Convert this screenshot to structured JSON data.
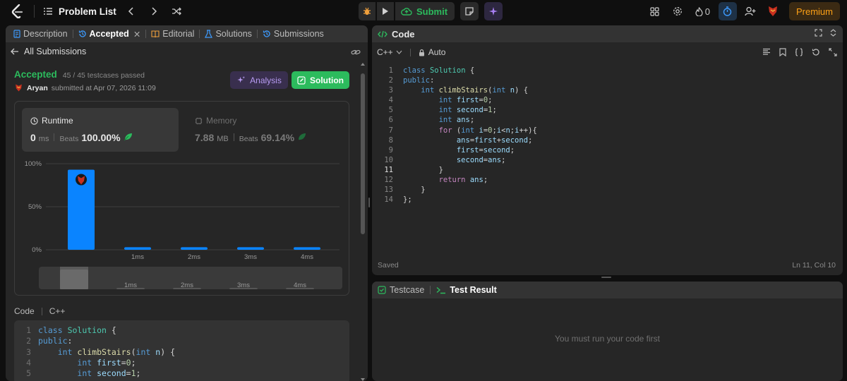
{
  "topbar": {
    "problem_list": "Problem List",
    "submit_label": "Submit",
    "streak_count": "0",
    "premium_label": "Premium"
  },
  "left": {
    "tabs": [
      "Description",
      "Accepted",
      "Editorial",
      "Solutions",
      "Submissions"
    ],
    "all_submissions": "All Submissions",
    "status": "Accepted",
    "testcases": "45 / 45 testcases passed",
    "user": "Aryan",
    "submitted_text": "submitted at Apr 07, 2026 11:09",
    "analysis_label": "Analysis",
    "solution_label": "Solution",
    "runtime_label": "Runtime",
    "runtime_value": "0",
    "runtime_unit": "ms",
    "runtime_beats_label": "Beats",
    "runtime_beats": "100.00%",
    "memory_label": "Memory",
    "memory_value": "7.88",
    "memory_unit": "MB",
    "memory_beats_label": "Beats",
    "memory_beats": "69.14%",
    "code_label": "Code",
    "code_lang": "C++"
  },
  "chart_data": {
    "type": "bar",
    "categories": [
      "0ms",
      "1ms",
      "2ms",
      "3ms",
      "4ms"
    ],
    "values": [
      93,
      3,
      3,
      3,
      3
    ],
    "tick_labels": [
      "",
      "1ms",
      "2ms",
      "3ms",
      "4ms"
    ],
    "ylim": [
      0,
      100
    ],
    "yticks": [
      "100%",
      "50%",
      "0%"
    ],
    "highlight_index": 0,
    "bar_color": "#0a84ff",
    "mini_labels": [
      "1ms",
      "2ms",
      "3ms",
      "4ms"
    ]
  },
  "left_code_lines": [
    {
      "n": "1",
      "t": "class Solution {"
    },
    {
      "n": "2",
      "t": "public:"
    },
    {
      "n": "3",
      "t": "    int climbStairs(int n) {"
    },
    {
      "n": "4",
      "t": "        int first=0;"
    },
    {
      "n": "5",
      "t": "        int second=1;"
    }
  ],
  "code_panel": {
    "title": "Code",
    "language": "C++",
    "mode": "Auto",
    "saved": "Saved",
    "cursor": "Ln 11, Col 10",
    "lines": [
      "class Solution {",
      "public:",
      "    int climbStairs(int n) {",
      "        int first=0;",
      "        int second=1;",
      "        int ans;",
      "        for (int i=0;i<n;i++){",
      "            ans=first+second;",
      "            first=second;",
      "            second=ans;",
      "        }",
      "        return ans;",
      "    }",
      "};"
    ]
  },
  "test_panel": {
    "tab1": "Testcase",
    "tab2": "Test Result",
    "message": "You must run your code first"
  },
  "colors": {
    "accent_green": "#2cbb5d",
    "premium_orange": "#ffa116",
    "analysis_purple": "#b79bf2",
    "bar_blue": "#0a84ff"
  }
}
